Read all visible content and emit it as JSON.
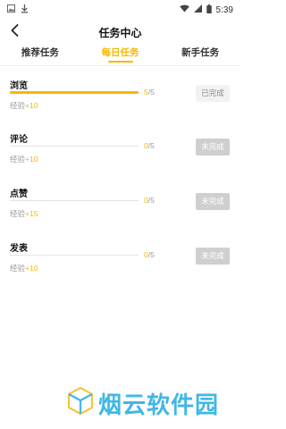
{
  "status_bar": {
    "time": "5:39"
  },
  "header": {
    "title": "任务中心"
  },
  "tabs": [
    {
      "label": "推荐任务",
      "active": false
    },
    {
      "label": "每日任务",
      "active": true
    },
    {
      "label": "新手任务",
      "active": false
    }
  ],
  "tasks": [
    {
      "title": "浏览",
      "current": "5",
      "total": "/5",
      "exp_label": "经验",
      "exp_value": "+10",
      "progress": 1.0,
      "status": "已完成",
      "state": "done"
    },
    {
      "title": "评论",
      "current": "0",
      "total": "/5",
      "exp_label": "经验",
      "exp_value": "+10",
      "progress": 0.0,
      "status": "未完成",
      "state": "todo"
    },
    {
      "title": "点赞",
      "current": "0",
      "total": "/5",
      "exp_label": "经验",
      "exp_value": "+15",
      "progress": 0.0,
      "status": "未完成",
      "state": "todo"
    },
    {
      "title": "发表",
      "current": "0",
      "total": "/5",
      "exp_label": "经验",
      "exp_value": "+10",
      "progress": 0.0,
      "status": "未完成",
      "state": "todo"
    }
  ],
  "watermark": {
    "text": "烟云软件园"
  },
  "colors": {
    "accent": "#F5B800",
    "done_bg": "#f2f2f2",
    "todo_bg": "#cfcfcf",
    "watermark": "#3fb7e8"
  }
}
